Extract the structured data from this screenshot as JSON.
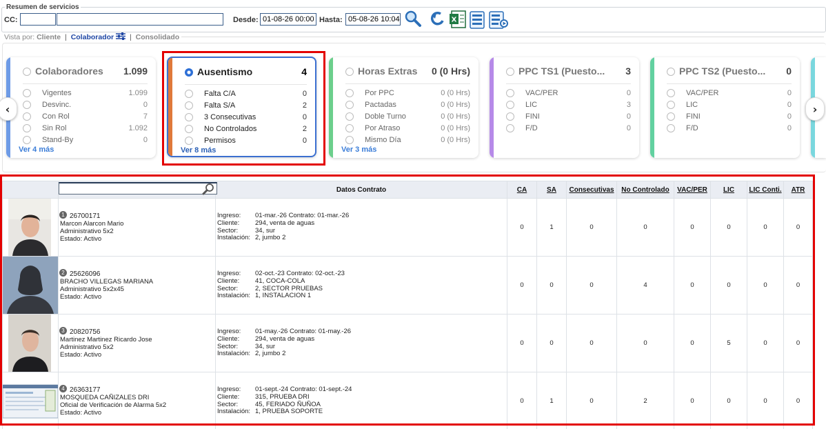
{
  "filters": {
    "legend": "Resumen de servicios",
    "cc_label": "CC:",
    "cc_code_value": "",
    "cc_name_value": "",
    "desde_label": "Desde:",
    "desde_value": "01-08-26 00:00",
    "hasta_label": "Hasta:",
    "hasta_value": "05-08-26 10:04"
  },
  "toolbar_icons": [
    "search-icon",
    "refresh-icon",
    "excel-export-icon",
    "report-list-icon",
    "report-settings-icon"
  ],
  "view": {
    "prefix": "Vista por:",
    "options": [
      "Cliente",
      "Colaborador",
      "Consolidado"
    ],
    "active": "Colaborador",
    "sep": "|"
  },
  "cards": [
    {
      "title": "Colaboradores",
      "total": "1.099",
      "accent": "#6e9be6",
      "selected": false,
      "more": "Ver 4 más",
      "items": [
        {
          "label": "Vigentes",
          "value": "1.099"
        },
        {
          "label": "Desvinc.",
          "value": "0"
        },
        {
          "label": "Con Rol",
          "value": "7"
        },
        {
          "label": "Sin Rol",
          "value": "1.092"
        },
        {
          "label": "Stand-By",
          "value": "0"
        }
      ]
    },
    {
      "title": "Ausentismo",
      "total": "4",
      "accent": "#e0793a",
      "selected": true,
      "more": "Ver 8 más",
      "items": [
        {
          "label": "Falta C/A",
          "value": "0"
        },
        {
          "label": "Falta S/A",
          "value": "2"
        },
        {
          "label": "3 Consecutivas",
          "value": "0"
        },
        {
          "label": "No Controlados",
          "value": "2"
        },
        {
          "label": "Permisos",
          "value": "0"
        }
      ]
    },
    {
      "title": "Horas Extras",
      "total": "0 (0 Hrs)",
      "accent": "#6ccf8c",
      "selected": false,
      "more": "Ver 3 más",
      "items": [
        {
          "label": "Por PPC",
          "value": "0 (0 Hrs)"
        },
        {
          "label": "Pactadas",
          "value": "0 (0 Hrs)"
        },
        {
          "label": "Doble Turno",
          "value": "0 (0 Hrs)"
        },
        {
          "label": "Por Atraso",
          "value": "0 (0 Hrs)"
        },
        {
          "label": "Mismo Día",
          "value": "0 (0 Hrs)"
        }
      ]
    },
    {
      "title": "PPC TS1 (Puesto...",
      "total": "3",
      "accent": "#b68ae8",
      "selected": false,
      "more": "",
      "items": [
        {
          "label": "VAC/PER",
          "value": "0"
        },
        {
          "label": "LIC",
          "value": "3"
        },
        {
          "label": "FINI",
          "value": "0"
        },
        {
          "label": "F/D",
          "value": "0"
        }
      ]
    },
    {
      "title": "PPC TS2 (Puesto...",
      "total": "0",
      "accent": "#62d1a0",
      "selected": false,
      "more": "",
      "items": [
        {
          "label": "VAC/PER",
          "value": "0"
        },
        {
          "label": "LIC",
          "value": "0"
        },
        {
          "label": "FINI",
          "value": "0"
        },
        {
          "label": "F/D",
          "value": "0"
        }
      ]
    }
  ],
  "table": {
    "contract_header": "Datos Contrato",
    "columns": [
      "CA",
      "SA",
      "Consecutivas",
      "No Controlado",
      "VAC/PER",
      "LIC",
      "LIC Conti.",
      "ATR"
    ],
    "contract_keys": [
      "Ingreso:",
      "Cliente:",
      "Sector:",
      "Instalación:"
    ],
    "rows": [
      {
        "index": "1",
        "rut": "26700171",
        "name": "Marcon Alarcon Mario",
        "role": "Administrativo 5x2",
        "status": "Estado: Activo",
        "ingreso": "01-mar.-26 Contrato: 01-mar.-26",
        "cliente": "294, venta de aguas",
        "sector": "34, sur",
        "instalacion": "2, jumbo 2",
        "values": [
          "0",
          "1",
          "0",
          "0",
          "0",
          "0",
          "0",
          "0"
        ]
      },
      {
        "index": "2",
        "rut": "25626096",
        "name": "BRACHO VILLEGAS MARIANA",
        "role": "Administrativo 5x2x45",
        "status": "Estado: Activo",
        "ingreso": "02-oct.-23 Contrato: 02-oct.-23",
        "cliente": "41, COCA-COLA",
        "sector": "2, SECTOR PRUEBAS",
        "instalacion": "1, INSTALACION 1",
        "values": [
          "0",
          "0",
          "0",
          "4",
          "0",
          "0",
          "0",
          "0"
        ]
      },
      {
        "index": "3",
        "rut": "20820756",
        "name": "Martinez Martinez Ricardo Jose",
        "role": "Administrativo 5x2",
        "status": "Estado: Activo",
        "ingreso": "01-may.-26 Contrato: 01-may.-26",
        "cliente": "294, venta de aguas",
        "sector": "34, sur",
        "instalacion": "2, jumbo 2",
        "values": [
          "0",
          "0",
          "0",
          "0",
          "0",
          "5",
          "0",
          "0"
        ]
      },
      {
        "index": "4",
        "rut": "26363177",
        "name": "MOSQUEDA CAÑIZALES DRI",
        "role": "Oficial de Verificación de Alarma 5x2",
        "status": "Estado: Activo",
        "ingreso": "01-sept.-24 Contrato: 01-sept.-24",
        "cliente": "315, PRUEBA DRI",
        "sector": "45, FERIADO ÑUÑOA",
        "instalacion": "1, PRUEBA SOPORTE",
        "values": [
          "0",
          "1",
          "0",
          "2",
          "0",
          "0",
          "0",
          "0"
        ]
      }
    ]
  }
}
